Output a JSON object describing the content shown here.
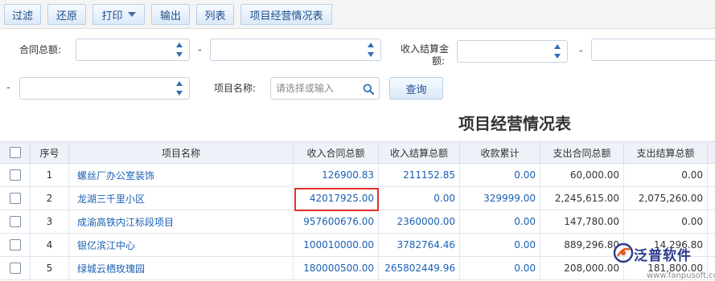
{
  "toolbar": {
    "filter": "过滤",
    "restore": "还原",
    "print": "打印",
    "export": "输出",
    "columns": "列表",
    "report": "项目经营情况表"
  },
  "filters": {
    "contract_total_label": "合同总额:",
    "income_settle_label_line1": "收入结算金",
    "income_settle_label_line2": "额:",
    "dash": "-",
    "project_name_label": "项目名称:",
    "project_name_placeholder": "请选择或输入",
    "query": "查询"
  },
  "report_title": "项目经营情况表",
  "table": {
    "headers": [
      "序号",
      "项目名称",
      "收入合同总额",
      "收入结算总额",
      "收款累计",
      "支出合同总额",
      "支出结算总额"
    ],
    "rows": [
      {
        "no": "1",
        "name": "螺丝厂办公室装饰",
        "income_contract": "126900.83",
        "income_settle": "211152.85",
        "received": "0.00",
        "expense_contract": "60,000.00",
        "expense_settle": "0.00"
      },
      {
        "no": "2",
        "name": "龙湖三千里小区",
        "income_contract": "42017925.00",
        "income_settle": "0.00",
        "received": "329999.00",
        "expense_contract": "2,245,615.00",
        "expense_settle": "2,075,260.00"
      },
      {
        "no": "3",
        "name": "成渝高铁内江标段项目",
        "income_contract": "957600676.00",
        "income_settle": "2360000.00",
        "received": "0.00",
        "expense_contract": "147,780.00",
        "expense_settle": "0.00"
      },
      {
        "no": "4",
        "name": "银亿滨江中心",
        "income_contract": "100010000.00",
        "income_settle": "3782764.46",
        "received": "0.00",
        "expense_contract": "889,296.80",
        "expense_settle": "14,296.80"
      },
      {
        "no": "5",
        "name": "绿城云栖玫瑰园",
        "income_contract": "180000500.00",
        "income_settle": "265802449.96",
        "received": "0.00",
        "expense_contract": "208,000.00",
        "expense_settle": "181,800.00"
      }
    ]
  },
  "watermark": {
    "brand": "泛普软件",
    "url": "www.fanpusoft.com"
  },
  "colors": {
    "link_blue": "#1a5fb4",
    "highlight_red": "#e0302a",
    "brand_navy": "#2b3a8c"
  }
}
